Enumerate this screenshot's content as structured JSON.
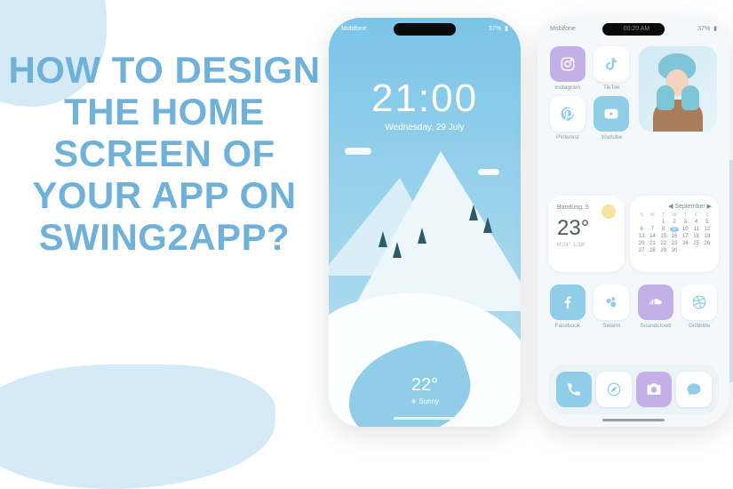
{
  "headline": "HOW TO DESIGN THE HOME SCREEN OF YOUR APP ON SWING2APP?",
  "lock_screen": {
    "carrier": "Mobifone",
    "battery": "37%",
    "time": "21:00",
    "date": "Wednesday, 29 July",
    "weather_temp": "22°",
    "weather_cond": "Sunny"
  },
  "home_screen": {
    "carrier": "Mobifone",
    "status_time": "00:20 AM",
    "battery": "37%",
    "apps_row1": [
      {
        "name": "instagram",
        "label": "Instagram",
        "bg": "bg-purple",
        "glyph": "instagram"
      },
      {
        "name": "tiktok",
        "label": "TikTok",
        "bg": "bg-white",
        "glyph": "tiktok"
      }
    ],
    "apps_row2": [
      {
        "name": "pinterest",
        "label": "Pinterest",
        "bg": "bg-white",
        "glyph": "pinterest"
      },
      {
        "name": "youtube",
        "label": "Youtube",
        "bg": "bg-blue",
        "glyph": "youtube"
      }
    ],
    "weather_widget": {
      "location": "Bandung, 9",
      "temp": "23°",
      "hi": "H:24°",
      "lo": "L:18°"
    },
    "calendar_widget": {
      "month": "September",
      "dow": [
        "S",
        "M",
        "T",
        "W",
        "T",
        "F",
        "S"
      ],
      "days": [
        "",
        "",
        "1",
        "2",
        "3",
        "4",
        "5",
        "6",
        "7",
        "8",
        "9",
        "10",
        "11",
        "12",
        "13",
        "14",
        "15",
        "16",
        "17",
        "18",
        "19",
        "20",
        "21",
        "22",
        "23",
        "24",
        "25",
        "26",
        "27",
        "28",
        "29",
        "30"
      ],
      "today": "9"
    },
    "apps_row3": [
      {
        "name": "facebook",
        "label": "Facebook",
        "bg": "bg-blue",
        "glyph": "facebook"
      },
      {
        "name": "swarm",
        "label": "Swarm",
        "bg": "bg-white",
        "glyph": "swarm"
      },
      {
        "name": "soundcloud",
        "label": "Soundcloud",
        "bg": "bg-purple",
        "glyph": "soundcloud"
      },
      {
        "name": "dribbble",
        "label": "Dribbble",
        "bg": "bg-white",
        "glyph": "dribbble"
      }
    ],
    "dock": [
      {
        "name": "phone",
        "bg": "bg-blue",
        "glyph": "phone"
      },
      {
        "name": "safari",
        "bg": "bg-white",
        "glyph": "safari"
      },
      {
        "name": "camera",
        "bg": "bg-purple",
        "glyph": "camera"
      },
      {
        "name": "messages",
        "bg": "bg-white",
        "glyph": "messages"
      }
    ]
  }
}
